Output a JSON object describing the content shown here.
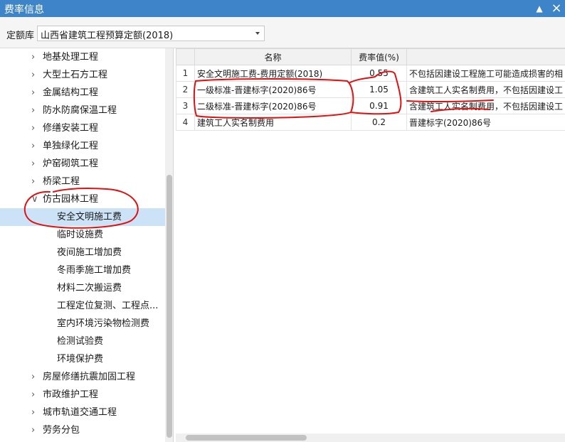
{
  "window": {
    "title": "费率信息",
    "min_label": "▲",
    "close_label": "×"
  },
  "library": {
    "label": "定额库",
    "value": "山西省建筑工程预算定额(2018)"
  },
  "tree": {
    "items": [
      {
        "label": "地基处理工程",
        "level": 0,
        "expanded": false
      },
      {
        "label": "大型土石方工程",
        "level": 0,
        "expanded": false
      },
      {
        "label": "金属结构工程",
        "level": 0,
        "expanded": false
      },
      {
        "label": "防水防腐保温工程",
        "level": 0,
        "expanded": false
      },
      {
        "label": "修缮安装工程",
        "level": 0,
        "expanded": false
      },
      {
        "label": "单独绿化工程",
        "level": 0,
        "expanded": false
      },
      {
        "label": "炉窑砌筑工程",
        "level": 0,
        "expanded": false
      },
      {
        "label": "桥梁工程",
        "level": 0,
        "expanded": false
      },
      {
        "label": "仿古园林工程",
        "level": 0,
        "expanded": true
      },
      {
        "label": "安全文明施工费",
        "level": 1,
        "selected": true
      },
      {
        "label": "临时设施费",
        "level": 1
      },
      {
        "label": "夜间施工增加费",
        "level": 1
      },
      {
        "label": "冬雨季施工增加费",
        "level": 1
      },
      {
        "label": "材料二次搬运费",
        "level": 1
      },
      {
        "label": "工程定位复测、工程点...",
        "level": 1
      },
      {
        "label": "室内环境污染物检测费",
        "level": 1
      },
      {
        "label": "检测试验费",
        "level": 1
      },
      {
        "label": "环境保护费",
        "level": 1
      },
      {
        "label": "房屋修缮抗震加固工程",
        "level": 0,
        "expanded": false
      },
      {
        "label": "市政维护工程",
        "level": 0,
        "expanded": false
      },
      {
        "label": "城市轨道交通工程",
        "level": 0,
        "expanded": false
      },
      {
        "label": "劳务分包",
        "level": 0,
        "expanded": false
      }
    ]
  },
  "table": {
    "columns": [
      "",
      "名称",
      "费率值(%)",
      ""
    ],
    "rows": [
      {
        "index": "1",
        "name": "安全文明施工费-费用定额(2018)",
        "rate": "0.55",
        "note": "不包括因建设工程施工可能造成损害的相"
      },
      {
        "index": "2",
        "name": "一级标准-晋建标字(2020)86号",
        "rate": "1.05",
        "note": "含建筑工人实名制费用，不包括因建设工"
      },
      {
        "index": "3",
        "name": "二级标准-晋建标字(2020)86号",
        "rate": "0.91",
        "note": "含建筑工人实名制费用，不包括因建设工"
      },
      {
        "index": "4",
        "name": "建筑工人实名制费用",
        "rate": "0.2",
        "note": "晋建标字(2020)86号"
      }
    ]
  },
  "colors": {
    "titlebar": "#3d84c8",
    "selected_row": "#cce3f7",
    "annotation": "#e01010"
  },
  "icons": {
    "expand_collapsed": "chevron-right-icon",
    "expand_open": "chevron-down-icon",
    "dropdown": "caret-down-icon"
  }
}
